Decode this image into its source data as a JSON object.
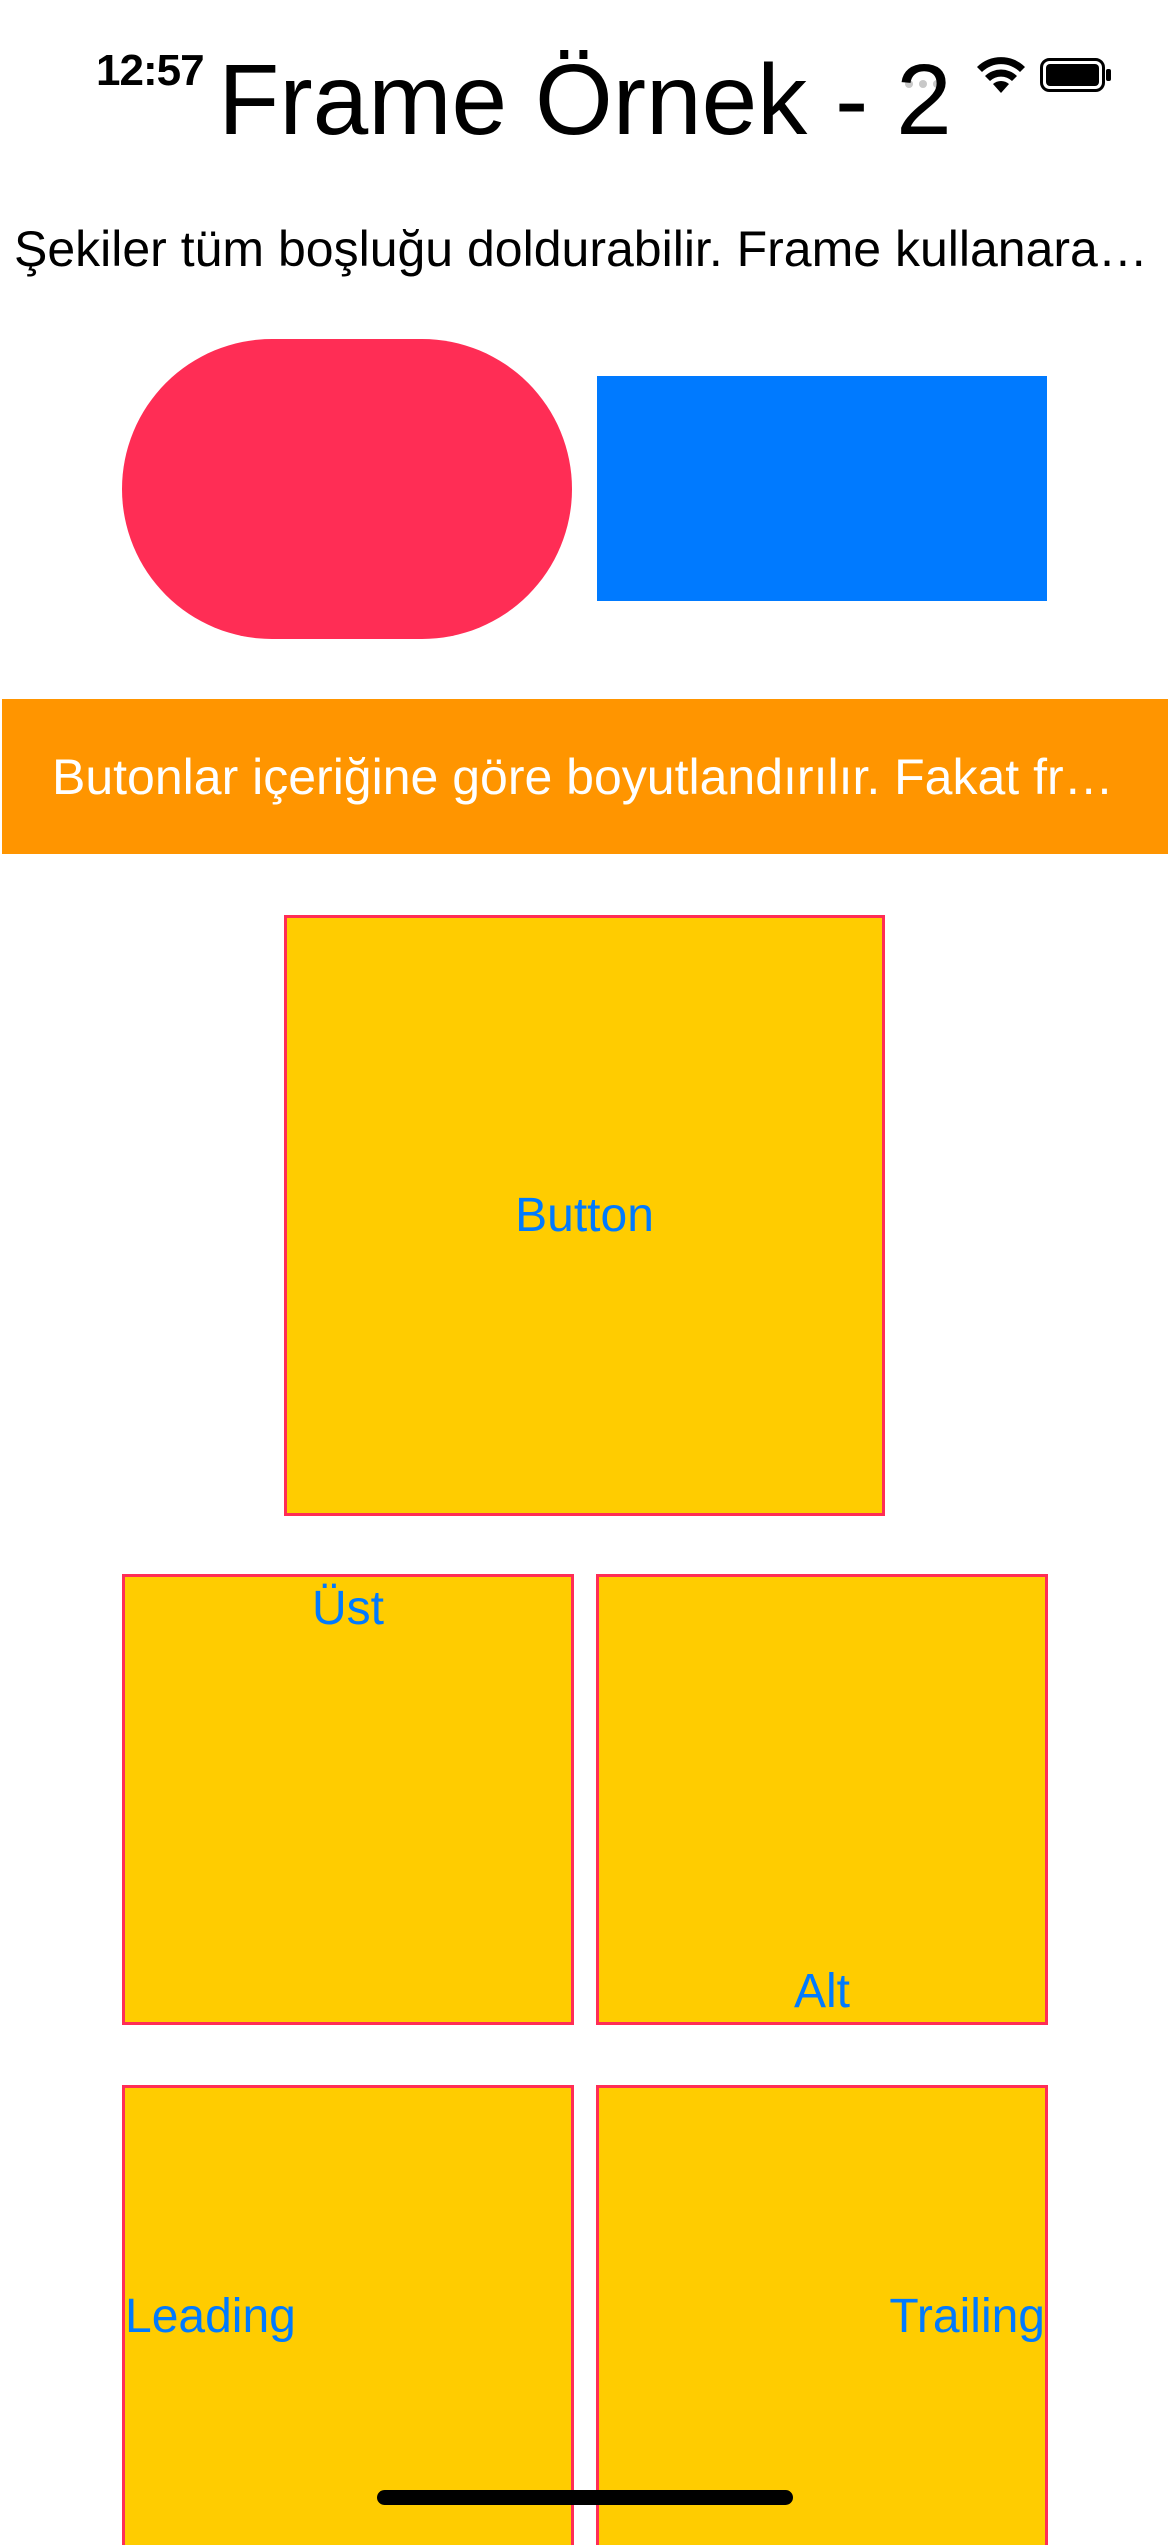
{
  "status_bar": {
    "time": "12:57",
    "icons": [
      "more-dots-icon",
      "wifi-icon",
      "battery-icon"
    ]
  },
  "navigation": {
    "title": "Frame Örnek - 2"
  },
  "shapes_section": {
    "description": "Şekiler tüm boşluğu doldurabilir. Frame kullanarak boyutlarını belirleyebiliriz.",
    "colors": {
      "capsule": "#ff2d55",
      "rectangle": "#007aff"
    }
  },
  "buttons_section": {
    "wide_button_label": "Butonlar içeriğine göre boyutlandırılır. Fakat frame ile boyutlandırılabilir.",
    "wide_button_color": "#ff9500",
    "center_button_label": "Button",
    "top_button_label": "Üst",
    "bottom_button_label": "Alt",
    "leading_button_label": "Leading",
    "trailing_button_label": "Trailing",
    "button_fill_color": "#ffcc00",
    "button_border_color": "#ff2d55",
    "button_text_color": "#007aff"
  }
}
